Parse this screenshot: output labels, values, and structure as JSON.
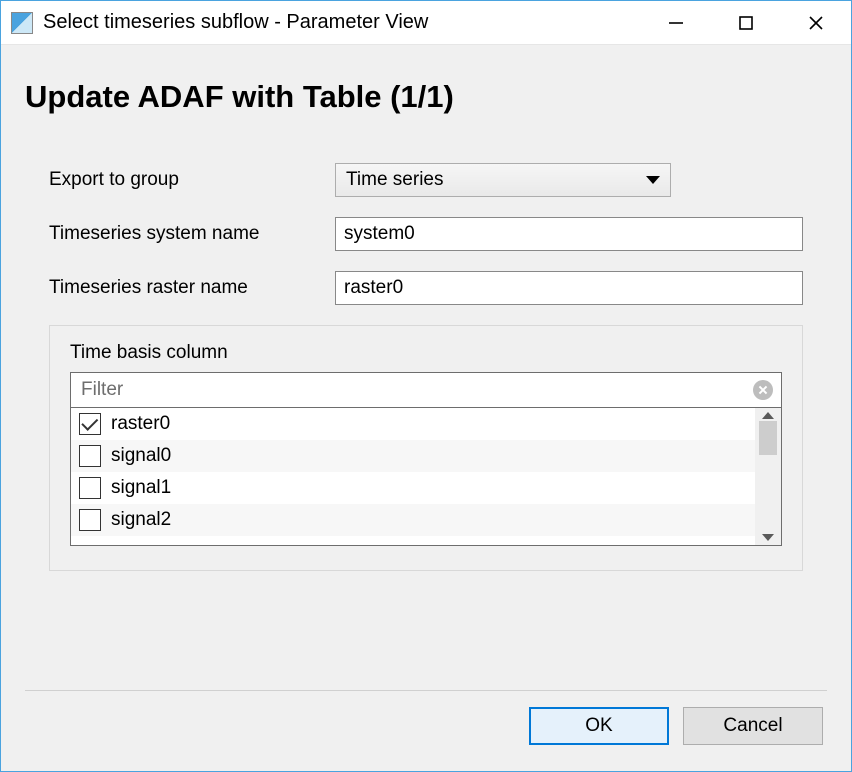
{
  "window": {
    "title": "Select timeseries subflow - Parameter View"
  },
  "page": {
    "heading": "Update ADAF with Table (1/1)"
  },
  "form": {
    "export_group": {
      "label": "Export to group",
      "value": "Time series"
    },
    "system_name": {
      "label": "Timeseries system name",
      "value": "system0"
    },
    "raster_name": {
      "label": "Timeseries raster name",
      "value": "raster0"
    }
  },
  "time_basis": {
    "label": "Time basis column",
    "filter_placeholder": "Filter",
    "items": [
      {
        "label": "raster0",
        "checked": true
      },
      {
        "label": "signal0",
        "checked": false
      },
      {
        "label": "signal1",
        "checked": false
      },
      {
        "label": "signal2",
        "checked": false
      }
    ]
  },
  "buttons": {
    "ok": "OK",
    "cancel": "Cancel"
  }
}
